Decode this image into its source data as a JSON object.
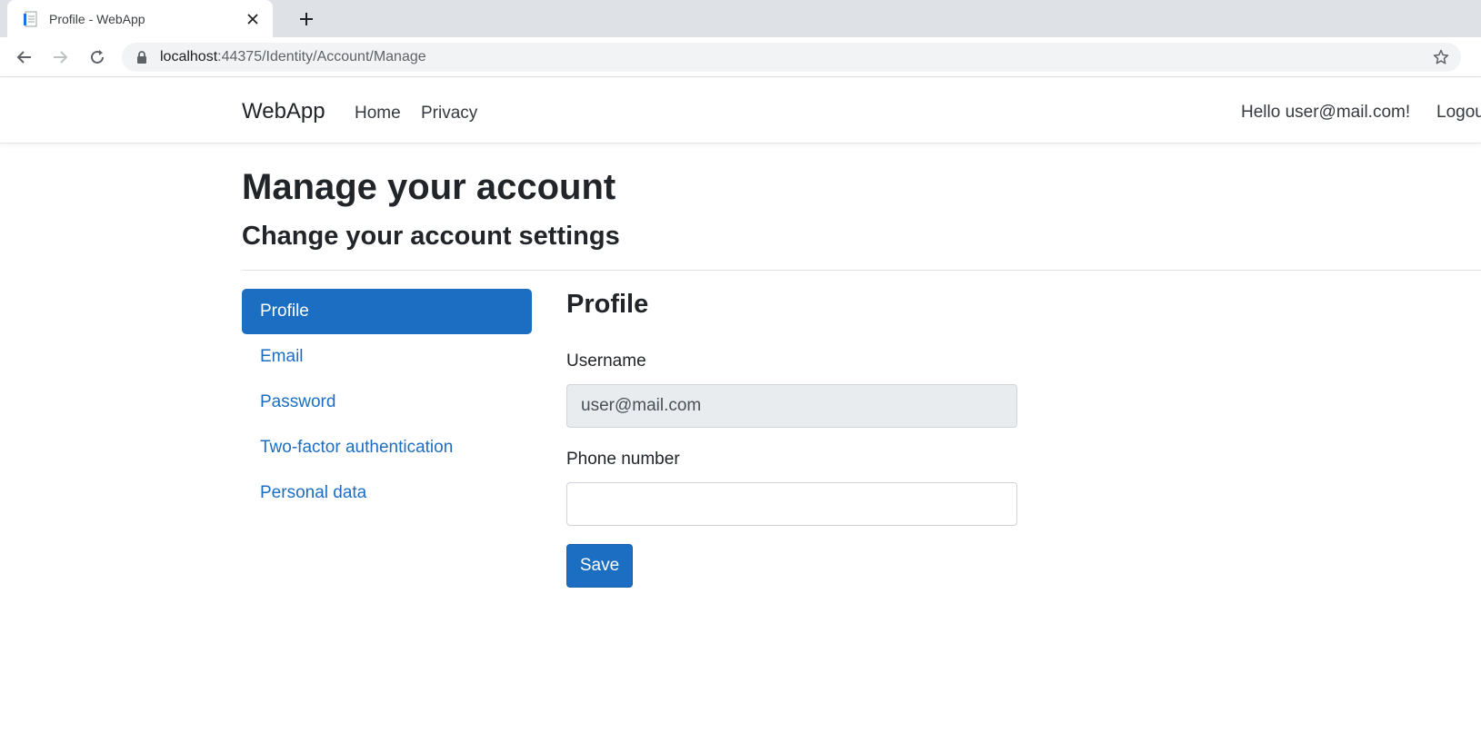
{
  "browser": {
    "tab_title": "Profile - WebApp",
    "url_host": "localhost",
    "url_rest": ":44375/Identity/Account/Manage"
  },
  "navbar": {
    "brand": "WebApp",
    "links": [
      "Home",
      "Privacy"
    ],
    "greeting": "Hello user@mail.com!",
    "logout": "Logout"
  },
  "page": {
    "title": "Manage your account",
    "subtitle": "Change your account settings"
  },
  "sidebar": {
    "items": [
      {
        "label": "Profile",
        "active": true
      },
      {
        "label": "Email",
        "active": false
      },
      {
        "label": "Password",
        "active": false
      },
      {
        "label": "Two-factor authentication",
        "active": false
      },
      {
        "label": "Personal data",
        "active": false
      }
    ]
  },
  "form": {
    "heading": "Profile",
    "username_label": "Username",
    "username_value": "user@mail.com",
    "phone_label": "Phone number",
    "phone_value": "",
    "save_label": "Save"
  },
  "colors": {
    "accent": "#1b6ec2",
    "text": "#212529",
    "readonly_bg": "#e9ecef"
  }
}
